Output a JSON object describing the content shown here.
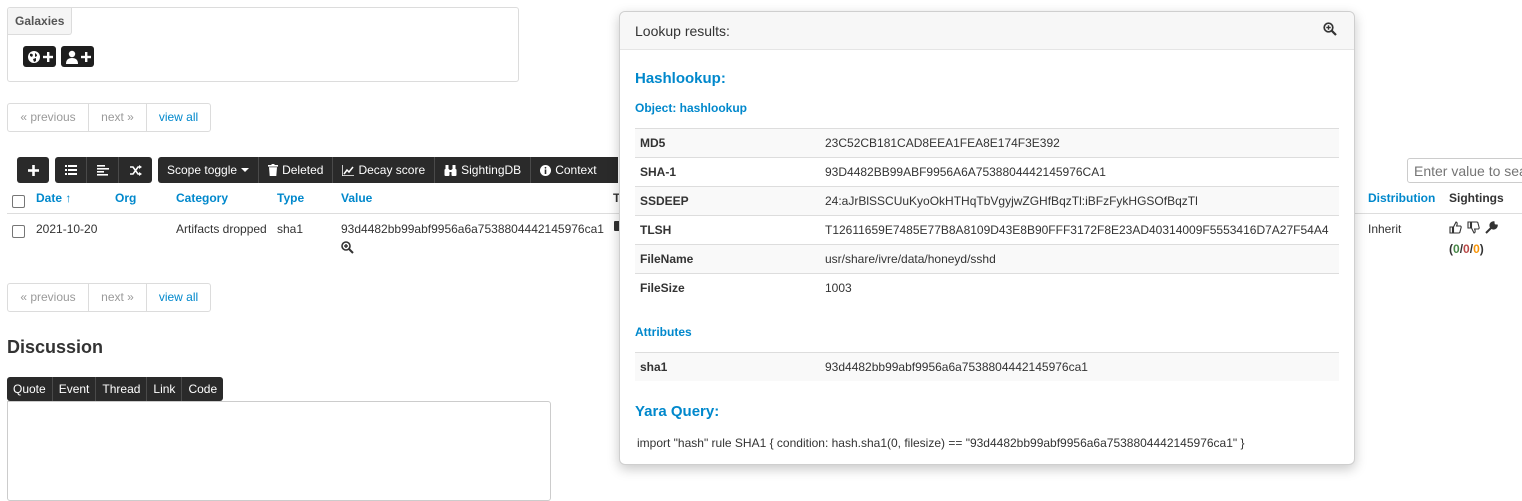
{
  "galaxies": {
    "title": "Galaxies",
    "buttons": [
      {
        "icon": "globe-plus-icon"
      },
      {
        "icon": "user-plus-icon"
      }
    ]
  },
  "pagination": {
    "previous": "« previous",
    "next": "next »",
    "view_all": "view all"
  },
  "toolbar": {
    "add_icon": "plus-icon",
    "view_icons": [
      "list-icon",
      "align-left-icon",
      "shuffle-icon"
    ],
    "items": [
      {
        "label": "Scope toggle",
        "icon": "caret-down-icon"
      },
      {
        "label": "Deleted",
        "icon": "trash-icon"
      },
      {
        "label": "Decay score",
        "icon": "area-chart-icon"
      },
      {
        "label": "SightingDB",
        "icon": "binoculars-icon"
      },
      {
        "label": "Context",
        "icon": "info-circle-icon"
      }
    ],
    "search_placeholder": "Enter value to search"
  },
  "table": {
    "columns": {
      "date": "Date ↑",
      "org": "Org",
      "category": "Category",
      "type": "Type",
      "value": "Value",
      "t": "T",
      "distribution": "Distribution",
      "sightings": "Sightings"
    },
    "rows": [
      {
        "date": "2021-10-20",
        "org": "",
        "category": "Artifacts dropped",
        "type": "sha1",
        "value": "93d4482bb99abf9956a6a7538804442145976ca1",
        "distribution": "Inherit",
        "sightings": {
          "positive": "0",
          "sep1": "/",
          "negative": "0",
          "sep2": "/",
          "expired": "0",
          "open": "(",
          "close": ")"
        }
      }
    ]
  },
  "discussion": {
    "title": "Discussion",
    "buttons": [
      "Quote",
      "Event",
      "Thread",
      "Link",
      "Code"
    ]
  },
  "lookup": {
    "title": "Lookup results:",
    "module": "Hashlookup:",
    "object_title": "Object: hashlookup",
    "object_rows": [
      {
        "key": "MD5",
        "value": "23C52CB181CAD8EEA1FEA8E174F3E392"
      },
      {
        "key": "SHA-1",
        "value": "93D4482BB99ABF9956A6A7538804442145976CA1"
      },
      {
        "key": "SSDEEP",
        "value": "24:aJrBlSSCUuKyoOkHTHqTbVgyjwZGHfBqzTl:iBFzFykHGSOfBqzTl"
      },
      {
        "key": "TLSH",
        "value": "T12611659E7485E77B8A8109D43E8B90FFF3172F8E23AD40314009F5553416D7A27F54A4"
      },
      {
        "key": "FileName",
        "value": "usr/share/ivre/data/honeyd/sshd"
      },
      {
        "key": "FileSize",
        "value": "1003"
      }
    ],
    "attributes_title": "Attributes",
    "attribute_rows": [
      {
        "key": "sha1",
        "value": "93d4482bb99abf9956a6a7538804442145976ca1"
      }
    ],
    "yara_title": "Yara Query:",
    "yara_query": "import \"hash\" rule SHA1 { condition: hash.sha1(0, filesize) == \"93d4482bb99abf9956a6a7538804442145976ca1\" }"
  },
  "colors": {
    "accent": "#0088cc",
    "toolbar": "#2a2a2a",
    "sighting_positive": "#468847",
    "sighting_negative": "#b94a48",
    "sighting_expired": "#f89406"
  }
}
